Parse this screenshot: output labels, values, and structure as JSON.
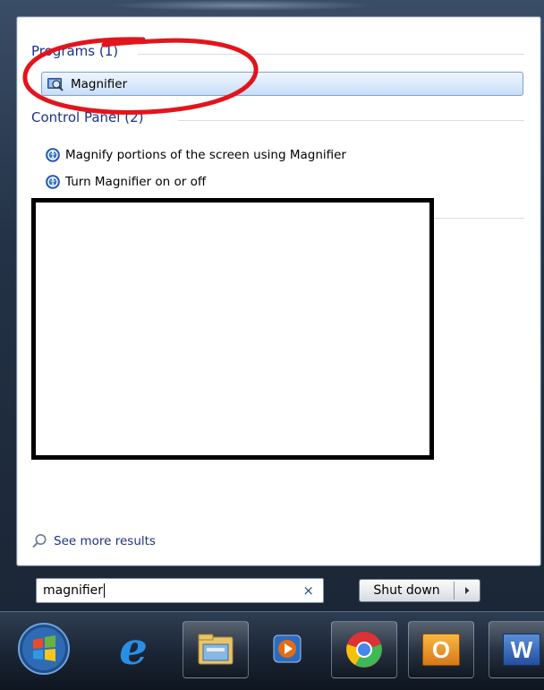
{
  "start_menu": {
    "programs_header": "Programs (1)",
    "program_items": [
      {
        "label": "Magnifier",
        "icon": "magnifier-app-icon"
      }
    ],
    "control_panel_header": "Control Panel (2)",
    "control_panel_items": [
      {
        "label": "Magnify portions of the screen using Magnifier",
        "icon": "ease-of-access-icon"
      },
      {
        "label": "Turn Magnifier on or off",
        "icon": "ease-of-access-icon"
      }
    ],
    "see_more": "See more results",
    "search": {
      "value": "magnifier",
      "clear": "×"
    },
    "shutdown": {
      "label": "Shut down",
      "arrow": "▸"
    }
  },
  "taskbar": {
    "items": [
      {
        "name": "start-orb-icon"
      },
      {
        "name": "internet-explorer-icon",
        "glyph": "e"
      },
      {
        "name": "windows-explorer-icon"
      },
      {
        "name": "media-player-icon"
      },
      {
        "name": "chrome-icon"
      },
      {
        "name": "outlook-icon",
        "glyph": "O"
      },
      {
        "name": "word-icon",
        "glyph": "W"
      }
    ]
  },
  "colors": {
    "header_blue": "#1e3287",
    "highlight_border": "#7da2ce",
    "annotation_red": "#e3141c"
  }
}
